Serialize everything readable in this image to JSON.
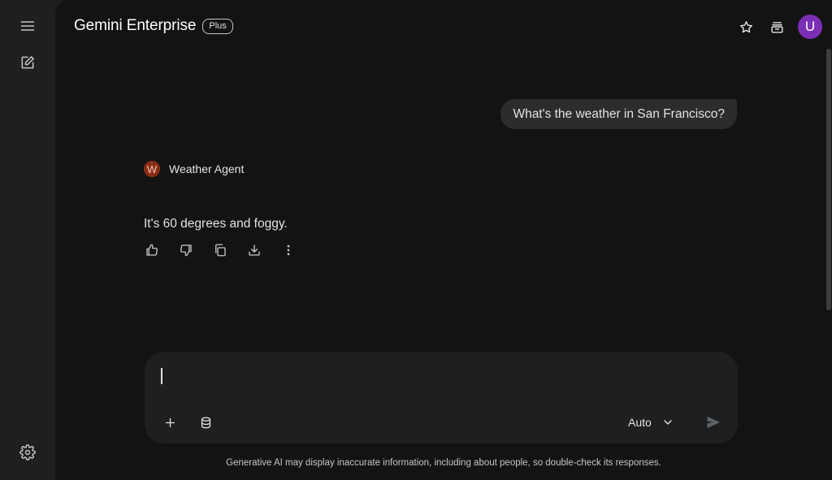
{
  "app": {
    "title": "Gemini Enterprise",
    "badge": "Plus",
    "user_initial": "U"
  },
  "rail": {
    "menu_icon": "menu-icon",
    "new_chat_icon": "edit-icon",
    "settings_icon": "gear-icon"
  },
  "topbar": {
    "icons": [
      "star-icon",
      "inbox-icon"
    ]
  },
  "conversation": {
    "user_message": "What's the weather in San Francisco?",
    "agent": {
      "initial": "W",
      "name": "Weather Agent",
      "message": "It's 60 degrees and foggy."
    },
    "message_actions": [
      "thumbs-up-icon",
      "thumbs-down-icon",
      "copy-icon",
      "download-icon",
      "more-vert-icon"
    ]
  },
  "composer": {
    "input_value": "",
    "placeholder": "",
    "model_label": "Auto",
    "tools": [
      "plus-icon",
      "database-icon"
    ],
    "send_icon": "send-icon"
  },
  "footer": {
    "disclaimer": "Generative AI may display inaccurate information, including about people, so double-check its responses."
  },
  "colors": {
    "avatar_user": "#7b2fb5",
    "avatar_agent": "#8a2c14",
    "surface": "#131314",
    "rail": "#1e1f20"
  }
}
